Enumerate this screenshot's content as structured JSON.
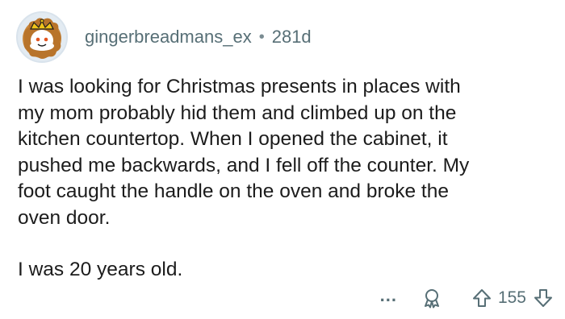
{
  "comment": {
    "author": "gingerbreadmans_ex",
    "separator": "•",
    "age": "281d",
    "paragraphs": [
      "I was looking for Christmas presents in places with\nmy mom probably hid them and climbed up on the\nkitchen countertop. When I opened the cabinet, it\npushed me backwards, and I fell off the counter. My\nfoot caught the handle on the oven and broke the\noven door.",
      "I was 20 years old."
    ]
  },
  "actions": {
    "more_label": "...",
    "vote_count": "155"
  },
  "icons": {
    "avatar": "snoo-avatar-icon",
    "award": "award-icon",
    "upvote": "upvote-arrow-icon",
    "downvote": "downvote-arrow-icon"
  },
  "colors": {
    "meta_text": "#576f76",
    "body_text": "#1c1c1c",
    "avatar_ring": "#d9e3ec",
    "avatar_hair": "#c9863a"
  }
}
